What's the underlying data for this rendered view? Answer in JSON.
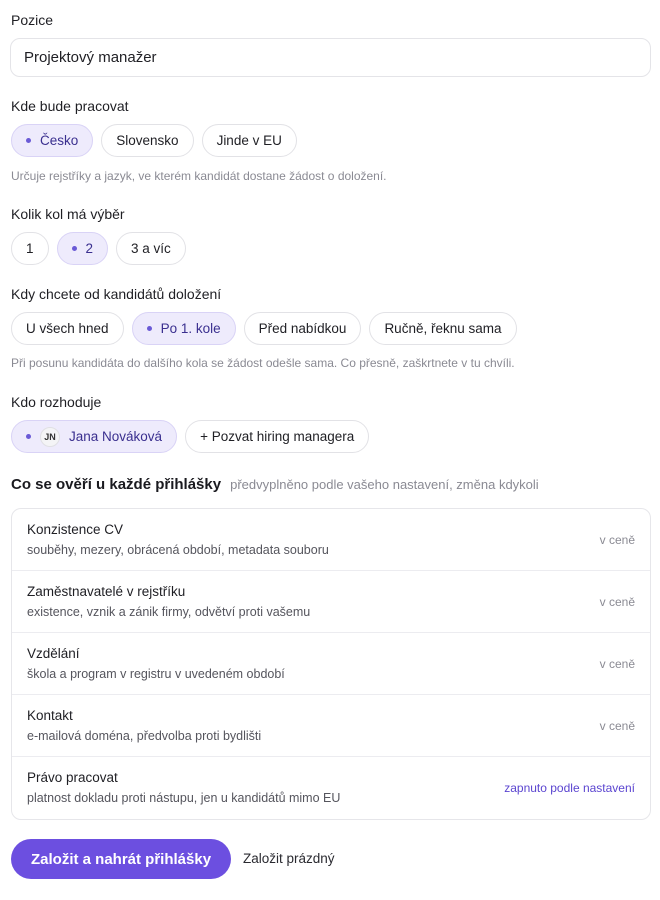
{
  "position": {
    "label": "Pozice",
    "value": "Projektový manažer"
  },
  "location": {
    "label": "Kde bude pracovat",
    "options": [
      "Česko",
      "Slovensko",
      "Jinde v EU"
    ],
    "selected": "Česko",
    "hint": "Určuje rejstříky a jazyk, ve kterém kandidát dostane žádost o doložení."
  },
  "rounds": {
    "label": "Kolik kol má výběr",
    "options": [
      "1",
      "2",
      "3 a víc"
    ],
    "selected": "2"
  },
  "timing": {
    "label": "Kdy chcete od kandidátů doložení",
    "options": [
      "U všech hned",
      "Po 1. kole",
      "Před nabídkou",
      "Ručně, řeknu sama"
    ],
    "selected": "Po 1. kole",
    "hint": "Při posunu kandidáta do dalšího kola se žádost odešle sama. Co přesně, zaškrtnete v tu chvíli."
  },
  "decider": {
    "label": "Kdo rozhoduje",
    "person_initials": "JN",
    "person_name": "Jana Nováková",
    "invite_label": "+ Pozvat hiring managera"
  },
  "checks": {
    "title": "Co se ověří u každé přihlášky",
    "subtitle": "předvyplněno podle vašeho nastavení, změna kdykoli",
    "items": [
      {
        "title": "Konzistence CV",
        "desc": "souběhy, mezery, obrácená období, metadata souboru",
        "status": "v ceně"
      },
      {
        "title": "Zaměstnavatelé v rejstříku",
        "desc": "existence, vznik a zánik firmy, odvětví proti vašemu",
        "status": "v ceně"
      },
      {
        "title": "Vzdělání",
        "desc": "škola a program v registru v uvedeném období",
        "status": "v ceně"
      },
      {
        "title": "Kontakt",
        "desc": "e-mailová doména, předvolba proti bydlišti",
        "status": "v ceně"
      },
      {
        "title": "Právo pracovat",
        "desc": "platnost dokladu proti nástupu, jen u kandidátů mimo EU",
        "status": "zapnuto podle nastavení"
      }
    ]
  },
  "actions": {
    "primary": "Založit a nahrát přihlášky",
    "secondary": "Založit prázdný"
  },
  "colors": {
    "accent": "#6c4fe0",
    "chip_selected_bg": "#eeebfc"
  }
}
